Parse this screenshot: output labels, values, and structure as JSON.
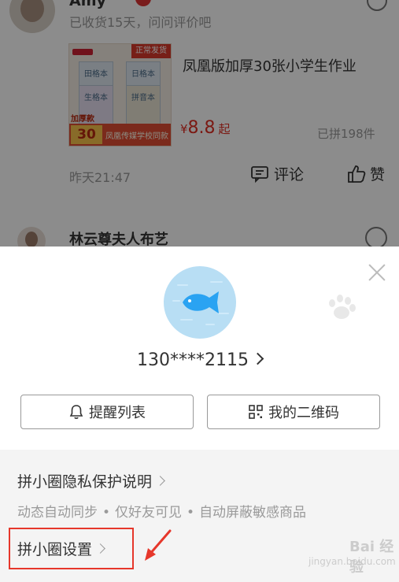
{
  "feed": {
    "post1": {
      "user_name": "Amy",
      "subtitle": "已收货15天，问问评价吧",
      "product_title": "凤凰版加厚30张小学生作业",
      "price_symbol": "¥",
      "price_value": "8.8",
      "price_suffix": "起",
      "sold_text": "已拼198件",
      "time": "昨天21:47",
      "comment_label": "评论",
      "like_label": "赞",
      "image": {
        "corner_tag": "正常发货",
        "book_label_1": "田格本",
        "book_label_2": "日格本",
        "book_label_3": "生格本",
        "book_label_4": "拼音本",
        "promo_top": "加厚款",
        "promo_count": "30张",
        "band_text": "凤凰传媒学校同款"
      }
    },
    "post2": {
      "user_name": "林云尊夫人布艺"
    }
  },
  "sheet": {
    "phone_number": "130****2115",
    "remind_list_label": "提醒列表",
    "qr_code_label": "我的二维码",
    "privacy_link": "拼小圈隐私保护说明",
    "features": [
      "动态自动同步",
      "仅好友可见",
      "自动屏蔽敏感商品"
    ],
    "feature_separator": "•",
    "settings_link": "拼小圈设置"
  },
  "watermark": {
    "text": "Bai 经验",
    "subtext": "jingyan.baidu.com"
  },
  "colors": {
    "price": "#e02e24",
    "highlight_box": "#e6372b",
    "avatar_bg": "#b8def4",
    "fish": "#2aa3f2"
  }
}
